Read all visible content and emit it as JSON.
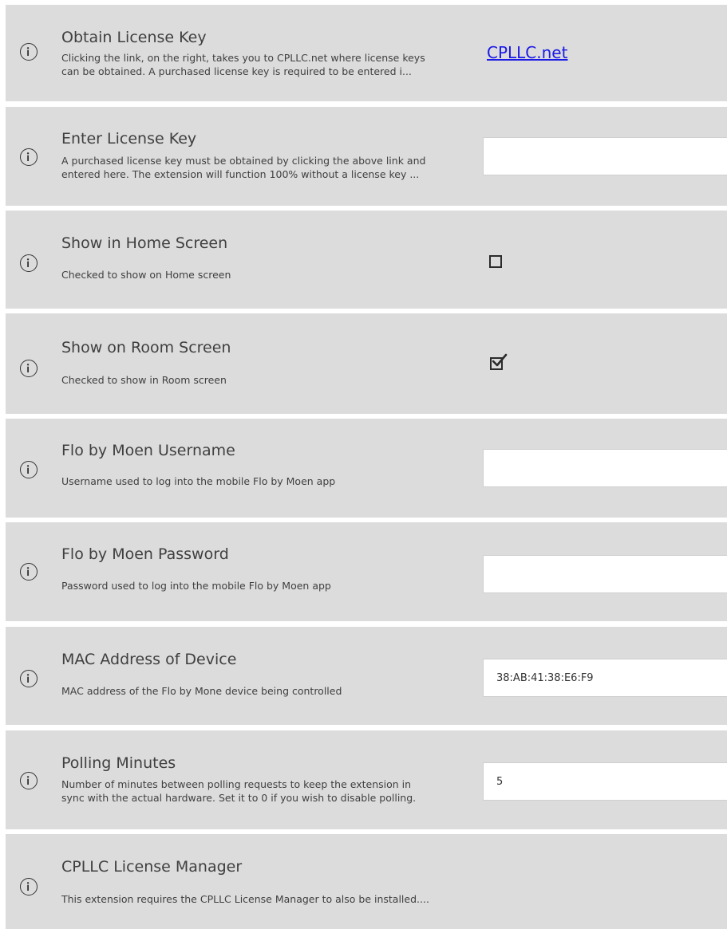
{
  "settings": [
    {
      "title": "Obtain License Key",
      "desc_lines": [
        "Clicking the link, on the right, takes you to CPLLC.net where license keys",
        "can be obtained.  A purchased license key is required to be entered i..."
      ],
      "link_text": "CPLLC.net"
    },
    {
      "title": "Enter License Key",
      "desc_lines": [
        "A purchased license key must be obtained by clicking the above link and",
        "entered here. The extension will function 100% without a license key ..."
      ],
      "value": ""
    },
    {
      "title": "Show in Home Screen",
      "desc_lines": [
        "Checked to show on Home screen"
      ],
      "checked": false
    },
    {
      "title": "Show on Room Screen",
      "desc_lines": [
        "Checked to show in Room screen"
      ],
      "checked": true
    },
    {
      "title": "Flo by Moen Username",
      "desc_lines": [
        "Username used to log into the mobile Flo by Moen app"
      ],
      "value": ""
    },
    {
      "title": "Flo by Moen Password",
      "desc_lines": [
        "Password used to log into the mobile Flo by Moen app"
      ],
      "value": ""
    },
    {
      "title": "MAC Address of Device",
      "desc_lines": [
        "MAC address of the Flo by Mone device being controlled"
      ],
      "value": "38:AB:41:38:E6:F9"
    },
    {
      "title": "Polling Minutes",
      "desc_lines": [
        "Number of minutes between polling requests to keep the extension in",
        "sync with the actual hardware. Set it to 0 if you wish to disable polling."
      ],
      "value": "5"
    },
    {
      "title": "CPLLC License Manager",
      "desc_lines": [
        "This extension requires the CPLLC License Manager to also be installed...."
      ]
    }
  ]
}
